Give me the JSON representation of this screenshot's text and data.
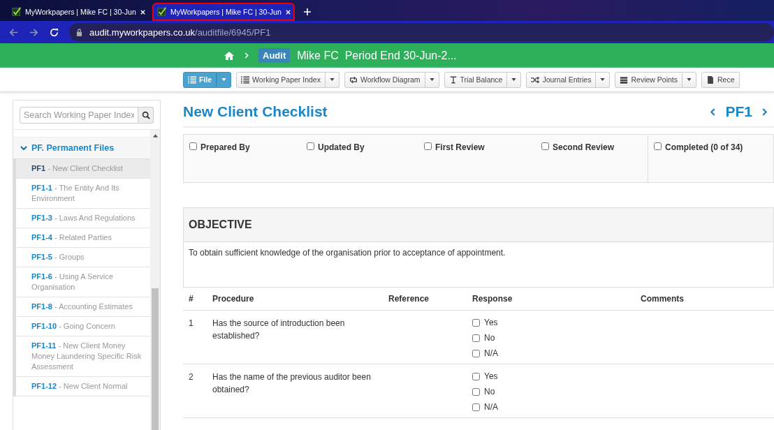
{
  "browser": {
    "tabs": [
      {
        "title": "MyWorkpapers | Mike FC | 30-Jun",
        "selected": false
      },
      {
        "title": "MyWorkpapers | Mike FC | 30-Jun",
        "selected": true
      }
    ],
    "url": {
      "host": "audit.myworkpapers.co.uk",
      "path": "/auditfile/6945/PF1"
    }
  },
  "header": {
    "badge": "Audit",
    "title": "Mike FC  Period End 30-Jun-2..."
  },
  "toolbar": [
    {
      "label": "File",
      "kind": "primary"
    },
    {
      "label": "Working Paper Index",
      "kind": "default"
    },
    {
      "label": "Workflow Diagram",
      "kind": "default"
    },
    {
      "label": "Trial Balance",
      "kind": "default"
    },
    {
      "label": "Journal Entries",
      "kind": "default"
    },
    {
      "label": "Review Points",
      "kind": "default"
    },
    {
      "label": "Rece",
      "kind": "cut"
    }
  ],
  "sidebar": {
    "search": {
      "placeholder": "Search Working Paper Index"
    },
    "section": {
      "title": "PF. Permanent Files",
      "expanded": true
    },
    "items": [
      {
        "label": "**PF1** - New Client Checklist",
        "selected": true
      },
      {
        "label": "**PF1-1** - The Entity And Its Environment",
        "selected": false
      },
      {
        "label": "**PF1-3** - Laws And Regulations",
        "selected": false
      },
      {
        "label": "**PF1-4** - Related Parties",
        "selected": false
      },
      {
        "label": "**PF1-5** - Groups",
        "selected": false
      },
      {
        "label": "**PF1-6** - Using A Service Organisation",
        "selected": false
      },
      {
        "label": "**PF1-8** - Accounting Estimates",
        "selected": false
      },
      {
        "label": "**PF1-10** - Going Concern",
        "selected": false
      },
      {
        "label": "**PF1-11** - New Client Money Money Laundering Specific Risk Assessment",
        "selected": false
      },
      {
        "label": "**PF1-12** - New Client Normal",
        "selected": false
      }
    ]
  },
  "page": {
    "title": "New Client Checklist",
    "code": "PF1",
    "signoffs": [
      {
        "label": "Prepared By",
        "checked": false
      },
      {
        "label": "Updated By",
        "checked": false
      },
      {
        "label": "First Review",
        "checked": false
      },
      {
        "label": "Second Review",
        "checked": false
      },
      {
        "label": "Completed (0 of 34)",
        "checked": false
      }
    ],
    "objective": {
      "heading": "OBJECTIVE",
      "text": "To obtain sufficient knowledge of the organisation prior to acceptance of appointment."
    },
    "table": {
      "columns": [
        "#",
        "Procedure",
        "Reference",
        "Response",
        "Comments"
      ],
      "rows": [
        {
          "number": "1",
          "procedure": "Has the source of introduction been established?",
          "responses": [
            {
              "label": "Yes",
              "checked": false
            },
            {
              "label": "No",
              "checked": false
            },
            {
              "label": "N/A",
              "checked": false
            }
          ]
        },
        {
          "number": "2",
          "procedure": "Has the name of the previous auditor been obtained?",
          "responses": [
            {
              "label": "Yes",
              "checked": false
            },
            {
              "label": "No",
              "checked": false
            },
            {
              "label": "N/A",
              "checked": false
            }
          ]
        }
      ]
    }
  }
}
